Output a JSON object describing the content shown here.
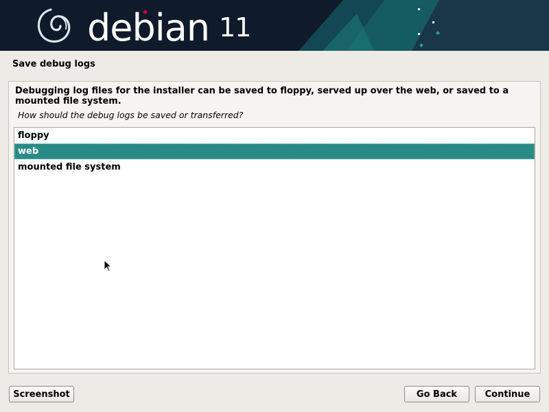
{
  "banner": {
    "brand": "debian",
    "version": "11"
  },
  "page_title": "Save debug logs",
  "panel": {
    "description": "Debugging log files for the installer can be saved to floppy, served up over the web, or saved to a mounted file system.",
    "question": "How should the debug logs be saved or transferred?",
    "options": [
      {
        "label": "floppy",
        "selected": false
      },
      {
        "label": "web",
        "selected": true
      },
      {
        "label": "mounted file system",
        "selected": false
      }
    ]
  },
  "buttons": {
    "screenshot": "Screenshot",
    "go_back": "Go Back",
    "continue": "Continue"
  },
  "colors": {
    "banner_bg": "#0f1a2b",
    "accent_teal": "#2a8b86",
    "swirl_red": "#c7053d"
  }
}
